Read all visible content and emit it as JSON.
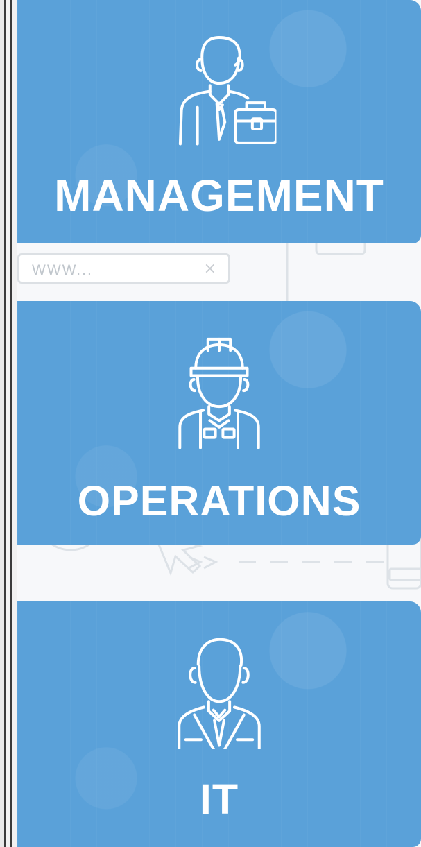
{
  "cards": [
    {
      "label": "MANAGEMENT",
      "icon": "manager-briefcase-icon"
    },
    {
      "label": "OPERATIONS",
      "icon": "worker-hardhat-icon"
    },
    {
      "label": "IT",
      "icon": "it-professional-icon"
    }
  ],
  "background": {
    "url_placeholder": "WWW...",
    "close_icon": "close-icon"
  },
  "colors": {
    "card": "#5aa1d9",
    "text": "#ffffff",
    "background": "#f7f8fa",
    "outline": "#d6dbe0"
  }
}
